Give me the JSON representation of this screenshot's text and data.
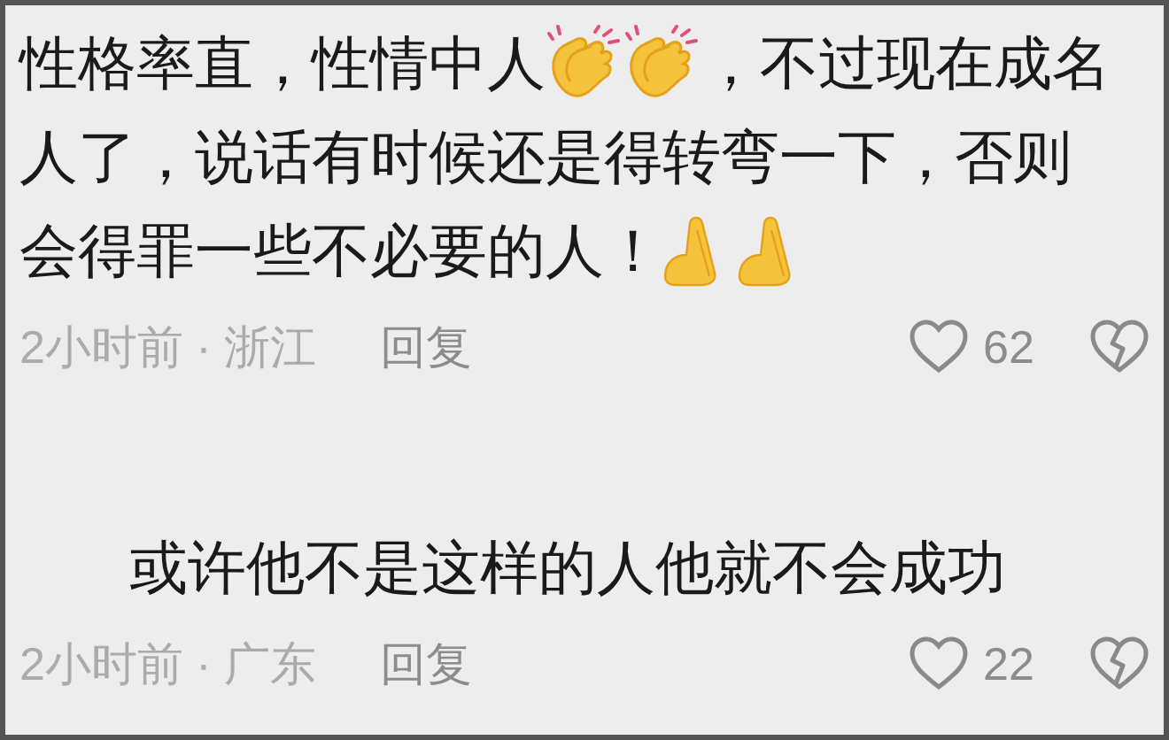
{
  "comments": [
    {
      "indent": false,
      "lines": [
        [
          {
            "kind": "text",
            "text": "性格率直，性情中人"
          },
          {
            "kind": "clap"
          },
          {
            "kind": "clap"
          },
          {
            "kind": "text",
            "text": "，不过现在成名"
          }
        ],
        [
          {
            "kind": "text",
            "text": "人了，说话有时候还是得转弯一下，否则"
          }
        ],
        [
          {
            "kind": "text",
            "text": "会得罪一些不必要的人！"
          },
          {
            "kind": "pray"
          },
          {
            "kind": "pray"
          }
        ]
      ],
      "meta": "2小时前 · 浙江",
      "reply": "回复",
      "likes": "62"
    },
    {
      "indent": true,
      "lines": [
        [
          {
            "kind": "text",
            "text": "或许他不是这样的人他就不会成功"
          }
        ]
      ],
      "meta": "2小时前 · 广东",
      "reply": "回复",
      "likes": "22"
    }
  ]
}
